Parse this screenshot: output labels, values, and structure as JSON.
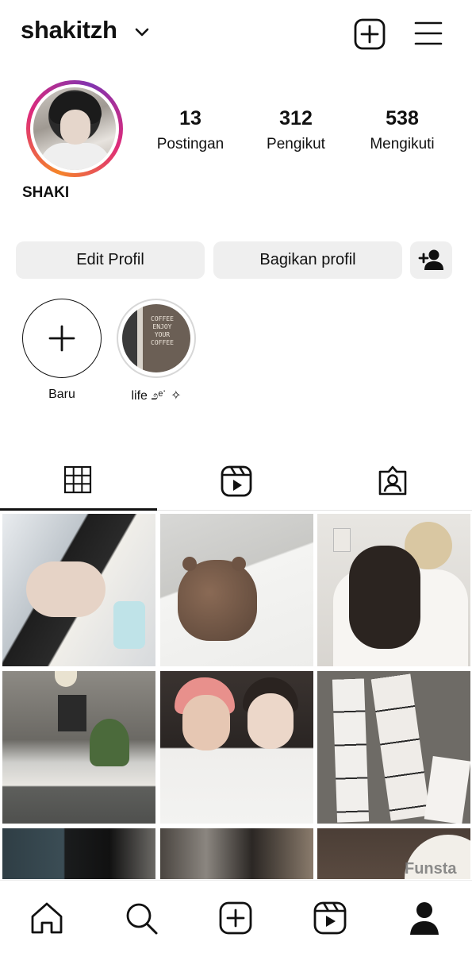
{
  "header": {
    "username": "shakitzh",
    "chevron_icon": "chevron-down-icon",
    "create_icon": "plus-square-icon",
    "menu_icon": "hamburger-menu-icon"
  },
  "profile": {
    "display_name": "SHAKI",
    "stats": [
      {
        "value": "13",
        "label": "Postingan"
      },
      {
        "value": "312",
        "label": "Pengikut"
      },
      {
        "value": "538",
        "label": "Mengikuti"
      }
    ]
  },
  "actions": {
    "edit_label": "Edit Profil",
    "share_label": "Bagikan profil",
    "discover_icon": "add-person-icon"
  },
  "highlights": [
    {
      "label": "Baru"
    },
    {
      "label": "life ೨ᵉ˙ ✧",
      "thumb_text": "COFFEE\nENJOY\nYOUR\nCOFFEE"
    }
  ],
  "tabs": {
    "items": [
      "grid-icon",
      "reels-icon",
      "tagged-icon"
    ],
    "active": "grid-icon"
  },
  "grid": {
    "posts": [
      {
        "desc": "portrait-dark-hair"
      },
      {
        "desc": "watercolor-bear"
      },
      {
        "desc": "person-holding-dog"
      },
      {
        "desc": "cafe-counter"
      },
      {
        "desc": "two-people-portrait"
      },
      {
        "desc": "photo-strips"
      },
      {
        "desc": "dark-portrait"
      },
      {
        "desc": "coffee-kettle"
      },
      {
        "desc": "moon-funstar"
      }
    ],
    "watermark": "Funsta"
  },
  "bottom_nav": {
    "items": [
      "home-icon",
      "search-icon",
      "create-icon",
      "reels-icon",
      "profile-icon"
    ],
    "active": "profile-icon"
  },
  "colors": {
    "button_bg": "#efefef",
    "ring_start": "#f58529",
    "ring_end": "#dd2a7b",
    "text": "#111111"
  }
}
